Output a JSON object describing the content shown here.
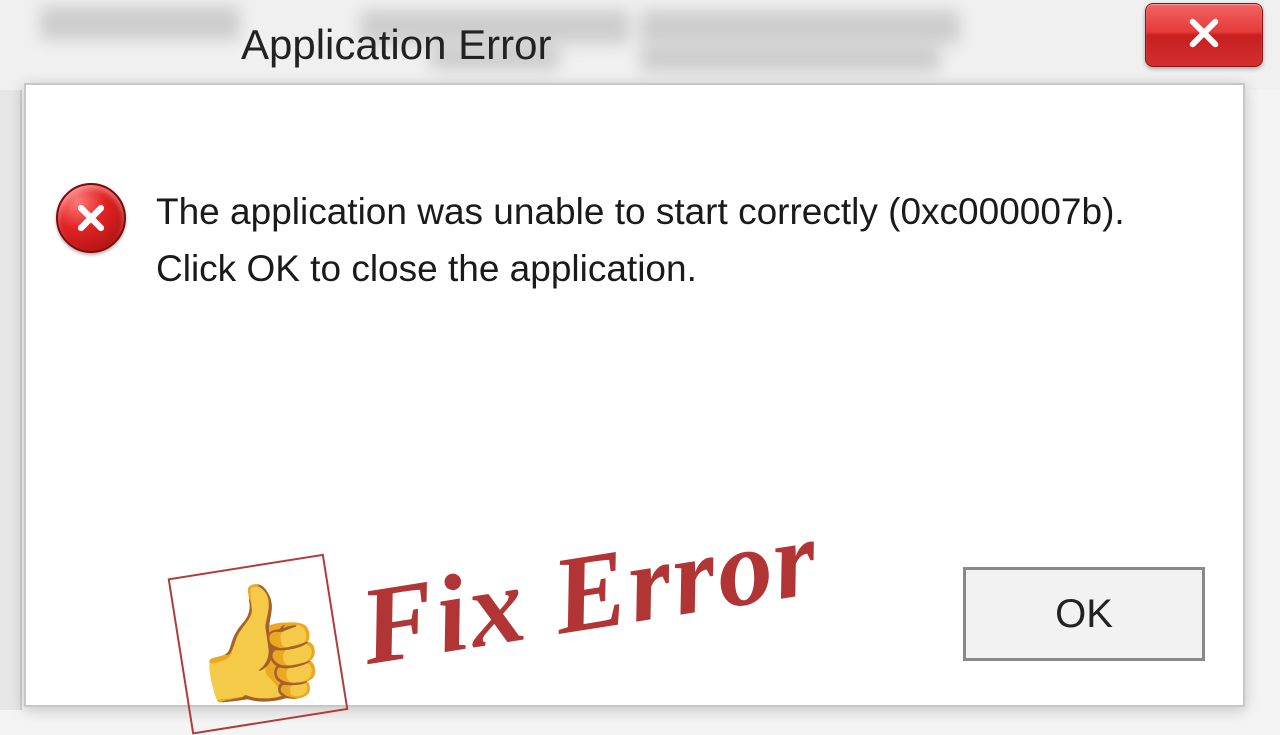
{
  "dialog": {
    "title": "Application Error",
    "message": "The application was unable to start correctly (0xc000007b). Click OK to close the application.",
    "ok_label": "OK"
  },
  "overlay": {
    "text": "Fix Error",
    "emoji": "👍"
  }
}
